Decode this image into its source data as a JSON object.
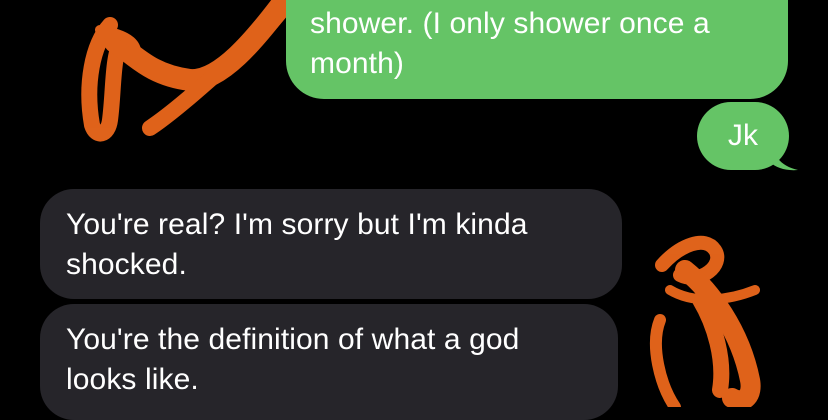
{
  "conversation": {
    "messages": [
      {
        "direction": "sent",
        "text": "shower. (I only shower once a\nmonth)"
      },
      {
        "direction": "sent",
        "text": "Jk"
      },
      {
        "direction": "received",
        "text": "You're real? I'm sorry but I'm kinda\nshocked."
      },
      {
        "direction": "received",
        "text": "You're the definition of what a god\nlooks like."
      }
    ]
  },
  "colors": {
    "background": "#000000",
    "sent_bubble": "#65c466",
    "received_bubble": "#26252a",
    "scribble": "#f26b1d"
  }
}
